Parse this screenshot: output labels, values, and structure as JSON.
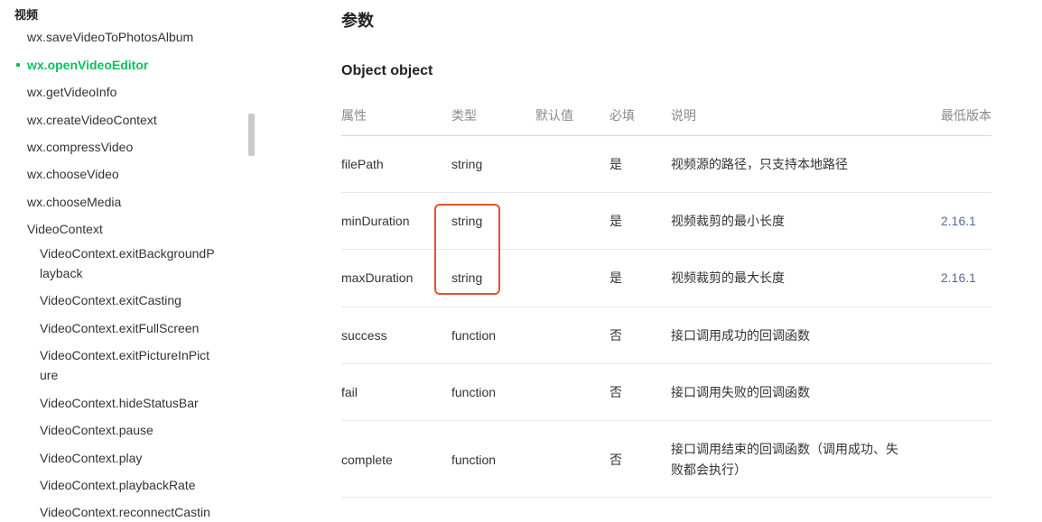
{
  "sidebar": {
    "section_title": "视频",
    "items": [
      {
        "label": "wx.saveVideoToPhotosAlbum"
      },
      {
        "label": "wx.openVideoEditor"
      },
      {
        "label": "wx.getVideoInfo"
      },
      {
        "label": "wx.createVideoContext"
      },
      {
        "label": "wx.compressVideo"
      },
      {
        "label": "wx.chooseVideo"
      },
      {
        "label": "wx.chooseMedia"
      },
      {
        "label": "VideoContext"
      },
      {
        "label": "VideoContext.exitBackgroundP",
        "label2": "layback"
      },
      {
        "label": "VideoContext.exitCasting"
      },
      {
        "label": "VideoContext.exitFullScreen"
      },
      {
        "label": "VideoContext.exitPictureInPict",
        "label2": "ure"
      },
      {
        "label": "VideoContext.hideStatusBar"
      },
      {
        "label": "VideoContext.pause"
      },
      {
        "label": "VideoContext.play"
      },
      {
        "label": "VideoContext.playbackRate"
      },
      {
        "label": "VideoContext.reconnectCastin"
      }
    ],
    "active_index": 1,
    "accent_color": "#07c160"
  },
  "main": {
    "section_heading": "参数",
    "object_heading": "Object object",
    "table": {
      "headers": [
        "属性",
        "类型",
        "默认值",
        "必填",
        "说明",
        "最低版本"
      ],
      "rows": [
        {
          "name": "filePath",
          "type": "string",
          "default": "",
          "required": "是",
          "desc": "视频源的路径，只支持本地路径",
          "version": ""
        },
        {
          "name": "minDuration",
          "type": "string",
          "default": "",
          "required": "是",
          "desc": "视频裁剪的最小长度",
          "version": "2.16.1"
        },
        {
          "name": "maxDuration",
          "type": "string",
          "default": "",
          "required": "是",
          "desc": "视频裁剪的最大长度",
          "version": "2.16.1"
        },
        {
          "name": "success",
          "type": "function",
          "default": "",
          "required": "否",
          "desc": "接口调用成功的回调函数",
          "version": ""
        },
        {
          "name": "fail",
          "type": "function",
          "default": "",
          "required": "否",
          "desc": "接口调用失败的回调函数",
          "version": ""
        },
        {
          "name": "complete",
          "type": "function",
          "default": "",
          "required": "否",
          "desc": "接口调用结束的回调函数（调用成功、失败都会执行）",
          "version": ""
        }
      ]
    },
    "highlight_color": "#e2532d",
    "version_link_color": "#576b95"
  }
}
